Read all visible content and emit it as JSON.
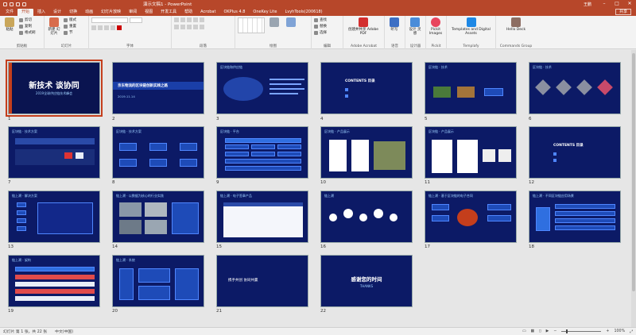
{
  "window": {
    "title": "演示文稿1 - PowerPoint",
    "user": "王鹏"
  },
  "tabs": [
    "文件",
    "开始",
    "插入",
    "设计",
    "切换",
    "动画",
    "幻灯片放映",
    "审阅",
    "视图",
    "开发工具",
    "帮助",
    "Acrobat",
    "OKPlus 4.8",
    "OneKey Lite",
    "LvyhTools(200618)"
  ],
  "active_tab": "开始",
  "share_label": "共享",
  "ribbon": {
    "groups": [
      {
        "label": "剪贴板",
        "big": "粘贴",
        "small": [
          "剪切",
          "复制",
          "格式刷"
        ]
      },
      {
        "label": "幻灯片",
        "big": "新建\n幻灯片",
        "small": [
          "版式",
          "重置",
          "节"
        ]
      },
      {
        "label": "字体"
      },
      {
        "label": "段落"
      },
      {
        "label": "绘图"
      },
      {
        "label": "编辑",
        "small": [
          "查找",
          "替换",
          "选择"
        ]
      },
      {
        "label": "Adobe Acrobat",
        "big": "创建并共享\nAdobe PDF"
      },
      {
        "label": "语音",
        "big": "听写"
      },
      {
        "label": "设计器",
        "big": "设计\n灵感"
      },
      {
        "label": "Pickit",
        "big": "Pickit\nImages"
      },
      {
        "label": "Templafy",
        "big": "Templates and\nDigital Assets"
      },
      {
        "label": "Commands Group",
        "big": "Hello\nDeck"
      }
    ]
  },
  "slides": [
    {
      "n": "1",
      "title": "新技术 谈协同",
      "sub": "2019全球供应链技术峰会"
    },
    {
      "n": "2",
      "title": "京东物流的区块链创新实践之路",
      "sub": "2019.11.14"
    },
    {
      "n": "3",
      "title": "区块链和供应链"
    },
    {
      "n": "4",
      "title": "CONTENTS 目录"
    },
    {
      "n": "5",
      "title": "区块链 · 技术"
    },
    {
      "n": "6",
      "title": "区块链 · 技术"
    },
    {
      "n": "7",
      "title": "区块链 · 技术方案"
    },
    {
      "n": "8",
      "title": "区块链 · 技术方案"
    },
    {
      "n": "9",
      "title": "区块链 · 平台"
    },
    {
      "n": "10",
      "title": "区块链 · 产品展示"
    },
    {
      "n": "11",
      "title": "区块链 · 产品展示"
    },
    {
      "n": "12",
      "title": "CONTENTS 目录"
    },
    {
      "n": "13",
      "title": "链上溯 · 解决方案"
    },
    {
      "n": "14",
      "title": "链上溯 · 以数据为核心的行业实践"
    },
    {
      "n": "15",
      "title": "链上溯 · 电子签章产品"
    },
    {
      "n": "16",
      "title": "链上溯"
    },
    {
      "n": "17",
      "title": "链上溯 · 基于区块链的电子合同"
    },
    {
      "n": "18",
      "title": "链上溯 · 不同区块链应用场景"
    },
    {
      "n": "19",
      "title": "链上溯 · 架构"
    },
    {
      "n": "20",
      "title": "链上溯 · 系统"
    },
    {
      "n": "21",
      "title": "携手共创 协同共赢"
    },
    {
      "n": "22",
      "title": "感谢您的时间",
      "sub": "THANKS"
    }
  ],
  "status": {
    "slide_info": "幻灯片 第 1 张，共 22 张",
    "language": "中文(中国)",
    "zoom": "100%"
  },
  "colors": {
    "accent": "#b7472a",
    "slide_bg": "#0c1a66"
  }
}
